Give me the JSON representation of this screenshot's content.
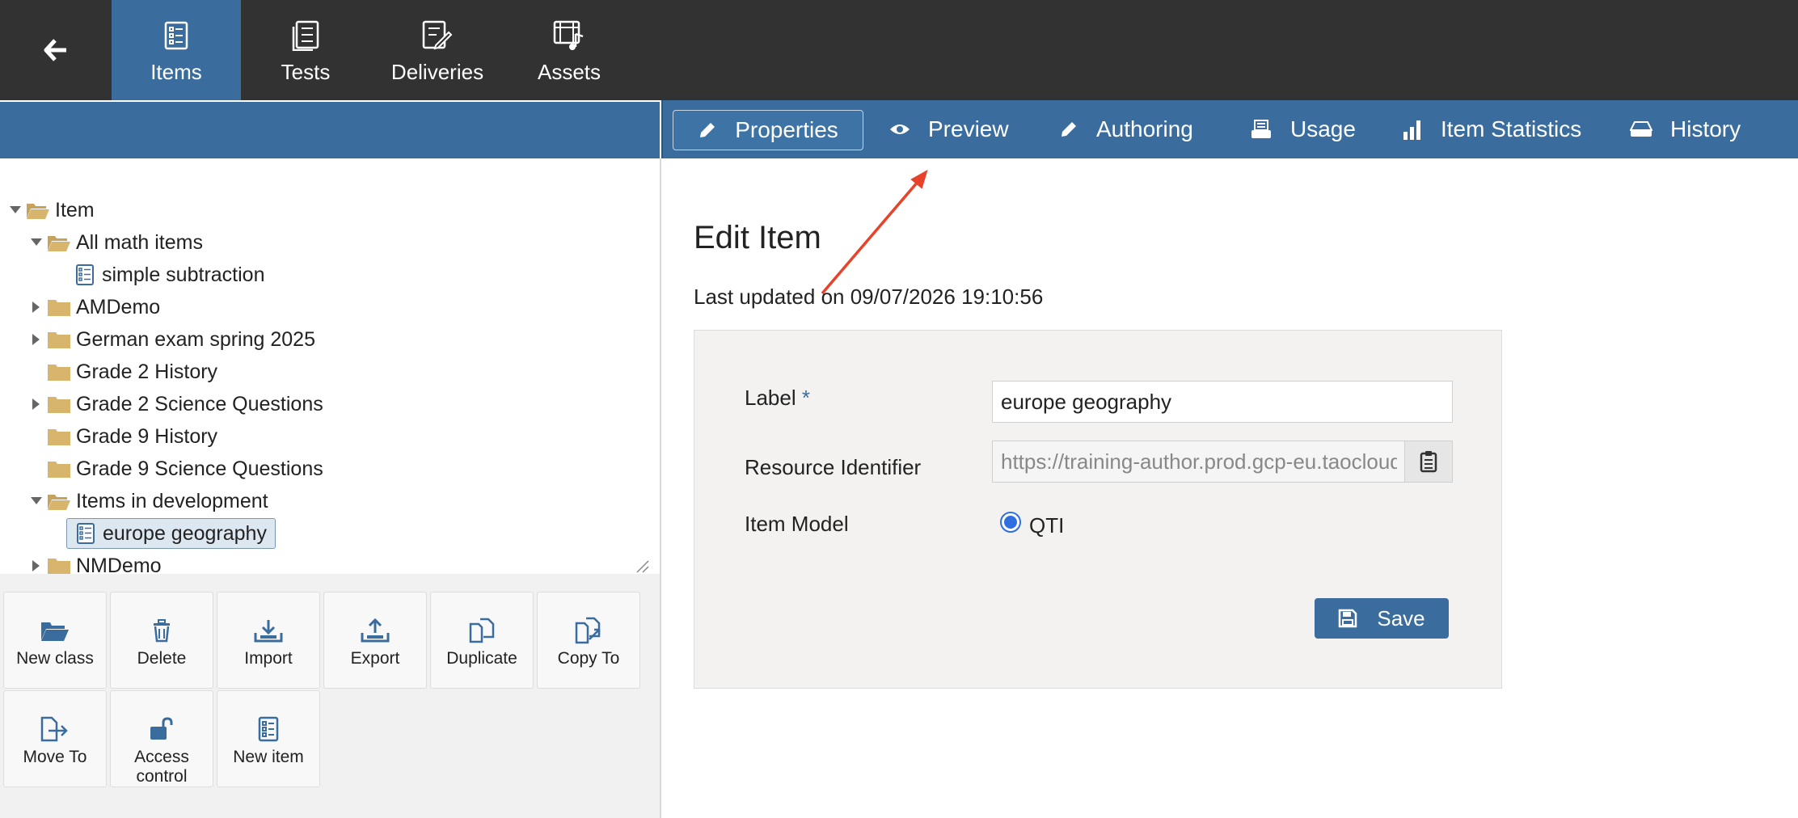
{
  "topnav": {
    "tabs": [
      {
        "label": "Items",
        "icon": "items-icon",
        "active": true
      },
      {
        "label": "Tests",
        "icon": "tests-icon"
      },
      {
        "label": "Deliveries",
        "icon": "deliveries-icon"
      },
      {
        "label": "Assets",
        "icon": "assets-icon"
      }
    ]
  },
  "actiontabs": [
    {
      "label": "Properties",
      "icon": "pencil-icon",
      "active": true
    },
    {
      "label": "Preview",
      "icon": "eye-icon"
    },
    {
      "label": "Authoring",
      "icon": "pencil-icon"
    },
    {
      "label": "Usage",
      "icon": "usage-icon"
    },
    {
      "label": "Item Statistics",
      "icon": "bar-chart-icon"
    },
    {
      "label": "History",
      "icon": "history-icon"
    }
  ],
  "tree": {
    "nodes": [
      {
        "label": "Item",
        "type": "folder-open",
        "expanded": true
      },
      {
        "label": "All math items",
        "type": "folder-open",
        "expanded": true
      },
      {
        "label": "simple subtraction",
        "type": "item"
      },
      {
        "label": "AMDemo",
        "type": "folder",
        "collapsed": true
      },
      {
        "label": "German exam spring 2025",
        "type": "folder",
        "collapsed": true
      },
      {
        "label": "Grade 2 History",
        "type": "folder"
      },
      {
        "label": "Grade 2 Science Questions",
        "type": "folder",
        "collapsed": true
      },
      {
        "label": "Grade 9 History",
        "type": "folder"
      },
      {
        "label": "Grade 9 Science Questions",
        "type": "folder"
      },
      {
        "label": "Items in development",
        "type": "folder-open",
        "expanded": true
      },
      {
        "label": "europe geography",
        "type": "item",
        "selected": true
      },
      {
        "label": "NMDemo",
        "type": "folder",
        "collapsed": true
      }
    ]
  },
  "actions": [
    {
      "label": "New class",
      "icon": "folder-open-icon"
    },
    {
      "label": "Delete",
      "icon": "trash-icon"
    },
    {
      "label": "Import",
      "icon": "import-icon"
    },
    {
      "label": "Export",
      "icon": "export-icon"
    },
    {
      "label": "Duplicate",
      "icon": "duplicate-icon"
    },
    {
      "label": "Copy To",
      "icon": "copy-to-icon"
    },
    {
      "label": "Move To",
      "icon": "move-to-icon"
    },
    {
      "label": "Access control",
      "icon": "lock-icon"
    },
    {
      "label": "New item",
      "icon": "new-item-icon"
    }
  ],
  "main": {
    "title": "Edit Item",
    "updated": "Last updated on 09/07/2026 19:10:56",
    "form": {
      "label_label": "Label",
      "required_mark": "*",
      "label_value": "europe geography",
      "resource_label": "Resource Identifier",
      "resource_value": "https://training-author.prod.gcp-eu.taocloud.org/",
      "model_label": "Item Model",
      "model_value": "QTI",
      "save_label": "Save"
    }
  },
  "colors": {
    "topbar": "#323232",
    "accent": "#3a6d9e",
    "annotation_arrow": "#e8432a"
  }
}
